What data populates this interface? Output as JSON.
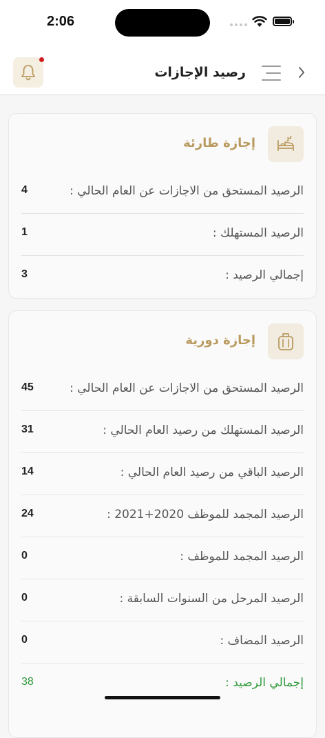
{
  "status": {
    "time": "2:06"
  },
  "header": {
    "title": "رصيد الإجازات"
  },
  "cards": [
    {
      "title": "إجازة طارئة",
      "icon": "bed-icon",
      "rows": [
        {
          "label": "الرصيد المستحق من الاجازات عن العام الحالي :",
          "value": "4"
        },
        {
          "label": "الرصيد المستهلك :",
          "value": "1"
        },
        {
          "label": "إجمالي الرصيد :",
          "value": "3"
        }
      ]
    },
    {
      "title": "إجازة دورية",
      "icon": "suitcase-icon",
      "rows": [
        {
          "label": "الرصيد المستحق من الاجازات عن العام الحالي :",
          "value": "45"
        },
        {
          "label": "الرصيد المستهلك من رصيد العام الحالي :",
          "value": "31"
        },
        {
          "label": "الرصيد الباقي من رصيد العام الحالي :",
          "value": "14"
        },
        {
          "label": "الرصيد المجمد للموظف 2020+2021 :",
          "value": "24"
        },
        {
          "label": "الرصيد المجمد للموظف :",
          "value": "0"
        },
        {
          "label": "الرصيد المرحل من السنوات السابقة :",
          "value": "0"
        },
        {
          "label": "الرصيد المضاف :",
          "value": "0"
        },
        {
          "label": "إجمالي الرصيد :",
          "value": "38"
        }
      ]
    }
  ],
  "colors": {
    "accent": "#b99a5f",
    "total": "#2f9a3b",
    "notification_dot": "#d11f1f"
  }
}
